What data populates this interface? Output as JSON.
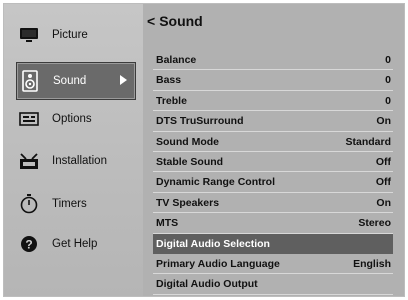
{
  "header": {
    "back_glyph": "<",
    "title": "Sound"
  },
  "sidebar": {
    "items": [
      {
        "label": "Picture",
        "icon": "tv-icon"
      },
      {
        "label": "Sound",
        "icon": "speaker-icon",
        "selected": true
      },
      {
        "label": "Options",
        "icon": "options-icon"
      },
      {
        "label": "Installation",
        "icon": "antenna-icon"
      },
      {
        "label": "Timers",
        "icon": "stopwatch-icon"
      },
      {
        "label": "Get Help",
        "icon": "help-icon"
      }
    ]
  },
  "settings": [
    {
      "label": "Balance",
      "value": "0"
    },
    {
      "label": "Bass",
      "value": "0"
    },
    {
      "label": "Treble",
      "value": "0"
    },
    {
      "label": "DTS TruSurround",
      "value": "On"
    },
    {
      "label": "Sound Mode",
      "value": "Standard"
    },
    {
      "label": "Stable Sound",
      "value": "Off"
    },
    {
      "label": "Dynamic Range Control",
      "value": "Off"
    },
    {
      "label": "TV Speakers",
      "value": "On"
    },
    {
      "label": "MTS",
      "value": "Stereo"
    },
    {
      "label": "Digital Audio Selection",
      "value": "",
      "selected": true
    },
    {
      "label": "Primary Audio Language",
      "value": "English"
    },
    {
      "label": "Digital Audio Output",
      "value": ""
    }
  ],
  "colors": {
    "selected_bg": "#5f5f5f",
    "panel_bg": "#b1b1b1",
    "sidebar_bg": "#c0c0c0"
  }
}
